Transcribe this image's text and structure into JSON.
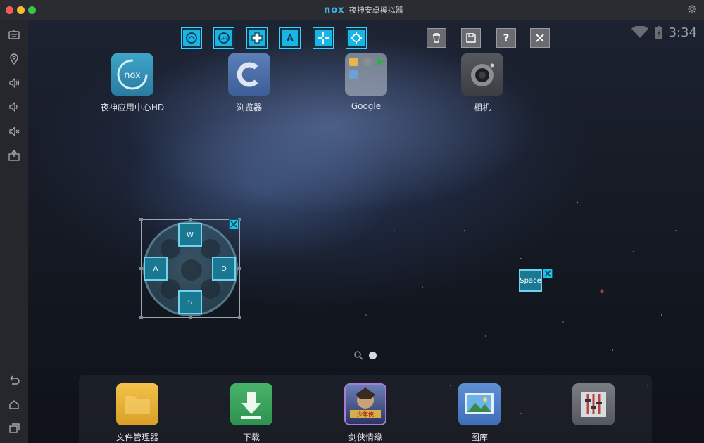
{
  "window": {
    "logo": "nox",
    "title": "夜神安卓模拟器"
  },
  "status": {
    "time": "3:34"
  },
  "toolbar": {
    "left_buttons": [
      {
        "icon": "gesture-icon"
      },
      {
        "icon": "gps-icon",
        "text": "GPS"
      },
      {
        "icon": "dpad-icon"
      },
      {
        "icon": "key-a-icon",
        "text": "A"
      },
      {
        "icon": "crosshair-icon"
      },
      {
        "icon": "aim-target-icon"
      }
    ],
    "right_buttons": [
      {
        "icon": "trash-icon"
      },
      {
        "icon": "save-icon"
      },
      {
        "icon": "help-icon",
        "text": "?"
      },
      {
        "icon": "close-icon"
      }
    ]
  },
  "sidebar": {
    "items": [
      "keyboard-icon",
      "location-pin-icon",
      "volume-up-icon",
      "volume-down-icon",
      "mute-icon",
      "install-apk-icon",
      "back-icon",
      "home-icon",
      "recent-apps-icon"
    ]
  },
  "apps": [
    {
      "label": "夜神应用中心HD"
    },
    {
      "label": "浏览器"
    },
    {
      "label": "Google"
    },
    {
      "label": "相机"
    }
  ],
  "dock": [
    {
      "label": "文件管理器"
    },
    {
      "label": "下载"
    },
    {
      "label": "剑侠情缘"
    },
    {
      "label": "图库"
    },
    {
      "label": ""
    }
  ],
  "keymap": {
    "up": "W",
    "left": "A",
    "right": "D",
    "down": "S",
    "space": "Space"
  },
  "game_icon_text": "少年侠",
  "colors": {
    "accent": "#18b5e6",
    "key_fill": "#1a7893",
    "key_border": "#6fd3ee"
  }
}
